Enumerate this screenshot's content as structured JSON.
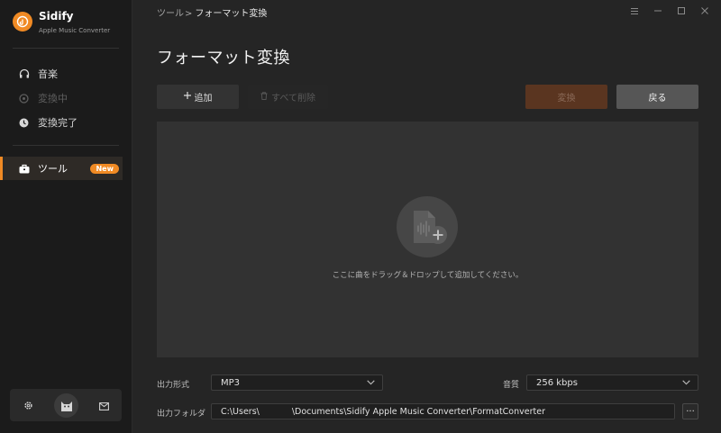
{
  "app": {
    "name": "Sidify",
    "subtitle": "Apple Music Converter"
  },
  "sidebar": {
    "items": [
      {
        "label": "音楽",
        "icon": "headphones-icon",
        "state": "normal"
      },
      {
        "label": "変換中",
        "icon": "spinner-icon",
        "state": "disabled"
      },
      {
        "label": "変換完了",
        "icon": "clock-icon",
        "state": "normal"
      },
      {
        "label": "ツール",
        "icon": "toolbox-icon",
        "state": "active",
        "badge": "New"
      }
    ],
    "bottom": {
      "settings_icon": "gear-icon",
      "avatar_icon": "avatar-cat-icon",
      "mail_icon": "mail-icon"
    }
  },
  "breadcrumb": {
    "parent": "ツール",
    "separator": ">",
    "current": "フォーマット変換"
  },
  "window_controls": [
    "menu-icon",
    "minimize-icon",
    "maximize-icon",
    "close-icon"
  ],
  "page": {
    "title": "フォーマット変換"
  },
  "toolbar": {
    "add_label": "追加",
    "clear_label": "すべて削除",
    "convert_label": "変換",
    "back_label": "戻る"
  },
  "dropzone": {
    "hint": "ここに曲をドラッグ＆ドロップして追加してください。",
    "icon": "audio-file-add-icon"
  },
  "settings": {
    "format_label": "出力形式",
    "format_value": "MP3",
    "quality_label": "音質",
    "quality_value": "256 kbps",
    "folder_label": "出力フォルダ",
    "folder_path_start": "C:\\Users\\",
    "folder_path_end": "\\Documents\\Sidify Apple Music Converter\\FormatConverter",
    "browse_label": "..."
  },
  "colors": {
    "accent": "#f08a24",
    "background": "#252525",
    "sidebar": "#1b1b1b"
  }
}
